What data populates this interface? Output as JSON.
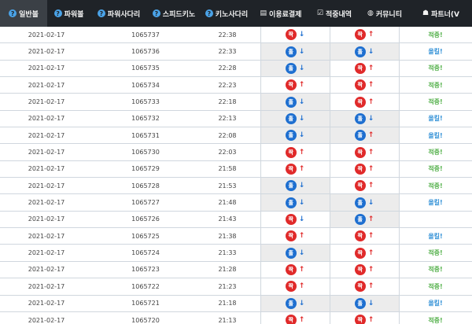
{
  "nav": {
    "items": [
      {
        "label": "일반볼",
        "icon": "question-icon",
        "glyph": "?",
        "active": true
      },
      {
        "label": "파워볼",
        "icon": "question-icon",
        "glyph": "?",
        "active": false
      },
      {
        "label": "파워사다리",
        "icon": "question-icon",
        "glyph": "?",
        "active": false
      },
      {
        "label": "스피드키노",
        "icon": "question-icon",
        "glyph": "?",
        "active": false
      },
      {
        "label": "키노사다리",
        "icon": "question-icon",
        "glyph": "?",
        "active": false
      },
      {
        "label": "이용료결제",
        "icon": "document-icon",
        "glyph": "▤",
        "active": false
      },
      {
        "label": "적중내역",
        "icon": "checkbox-icon",
        "glyph": "☑",
        "active": false
      },
      {
        "label": "커뮤니티",
        "icon": "globe-icon",
        "glyph": "◍",
        "active": false
      },
      {
        "label": "파트너(V",
        "icon": "users-icon",
        "glyph": "☗",
        "active": false
      }
    ]
  },
  "colors": {
    "navbar": "#1f2328",
    "odd_ball": "#e02a2a",
    "even_ball": "#1e6fd0",
    "hit": "#53b04a",
    "miss": "#2f8fd6"
  },
  "rows": [
    {
      "date": "2021-02-17",
      "round": "1065737",
      "time": "22:38",
      "p1": "짝",
      "p1_arrow": "↓",
      "p2": "짝",
      "p2_arrow": "↑",
      "result": "적중!",
      "grey1": false,
      "grey2": false
    },
    {
      "date": "2021-02-17",
      "round": "1065736",
      "time": "22:33",
      "p1": "홀",
      "p1_arrow": "↓",
      "p2": "홀",
      "p2_arrow": "↓",
      "result": "올킬!",
      "grey1": true,
      "grey2": true
    },
    {
      "date": "2021-02-17",
      "round": "1065735",
      "time": "22:28",
      "p1": "홀",
      "p1_arrow": "↓",
      "p2": "짝",
      "p2_arrow": "↑",
      "result": "적중!",
      "grey1": true,
      "grey2": false
    },
    {
      "date": "2021-02-17",
      "round": "1065734",
      "time": "22:23",
      "p1": "짝",
      "p1_arrow": "↑",
      "p2": "짝",
      "p2_arrow": "↑",
      "result": "적중!",
      "grey1": false,
      "grey2": false
    },
    {
      "date": "2021-02-17",
      "round": "1065733",
      "time": "22:18",
      "p1": "홀",
      "p1_arrow": "↓",
      "p2": "짝",
      "p2_arrow": "↑",
      "result": "적중!",
      "grey1": true,
      "grey2": false
    },
    {
      "date": "2021-02-17",
      "round": "1065732",
      "time": "22:13",
      "p1": "홀",
      "p1_arrow": "↓",
      "p2": "홀",
      "p2_arrow": "↓",
      "result": "올킬!",
      "grey1": true,
      "grey2": true
    },
    {
      "date": "2021-02-17",
      "round": "1065731",
      "time": "22:08",
      "p1": "홀",
      "p1_arrow": "↓",
      "p2": "홀",
      "p2_arrow": "↑",
      "result": "올킬!",
      "grey1": true,
      "grey2": true
    },
    {
      "date": "2021-02-17",
      "round": "1065730",
      "time": "22:03",
      "p1": "짝",
      "p1_arrow": "↑",
      "p2": "짝",
      "p2_arrow": "↑",
      "result": "적중!",
      "grey1": false,
      "grey2": false
    },
    {
      "date": "2021-02-17",
      "round": "1065729",
      "time": "21:58",
      "p1": "짝",
      "p1_arrow": "↑",
      "p2": "짝",
      "p2_arrow": "↑",
      "result": "적중!",
      "grey1": false,
      "grey2": false
    },
    {
      "date": "2021-02-17",
      "round": "1065728",
      "time": "21:53",
      "p1": "홀",
      "p1_arrow": "↓",
      "p2": "짝",
      "p2_arrow": "↑",
      "result": "적중!",
      "grey1": true,
      "grey2": false
    },
    {
      "date": "2021-02-17",
      "round": "1065727",
      "time": "21:48",
      "p1": "홀",
      "p1_arrow": "↓",
      "p2": "홀",
      "p2_arrow": "↓",
      "result": "올킬!",
      "grey1": true,
      "grey2": true
    },
    {
      "date": "2021-02-17",
      "round": "1065726",
      "time": "21:43",
      "p1": "짝",
      "p1_arrow": "↓",
      "p2": "홀",
      "p2_arrow": "↑",
      "result": "",
      "grey1": false,
      "grey2": true
    },
    {
      "date": "2021-02-17",
      "round": "1065725",
      "time": "21:38",
      "p1": "짝",
      "p1_arrow": "↑",
      "p2": "짝",
      "p2_arrow": "↑",
      "result": "올킬!",
      "grey1": false,
      "grey2": false
    },
    {
      "date": "2021-02-17",
      "round": "1065724",
      "time": "21:33",
      "p1": "홀",
      "p1_arrow": "↓",
      "p2": "짝",
      "p2_arrow": "↑",
      "result": "적중!",
      "grey1": true,
      "grey2": false
    },
    {
      "date": "2021-02-17",
      "round": "1065723",
      "time": "21:28",
      "p1": "짝",
      "p1_arrow": "↑",
      "p2": "짝",
      "p2_arrow": "↑",
      "result": "적중!",
      "grey1": false,
      "grey2": false
    },
    {
      "date": "2021-02-17",
      "round": "1065722",
      "time": "21:23",
      "p1": "짝",
      "p1_arrow": "↑",
      "p2": "짝",
      "p2_arrow": "↑",
      "result": "적중!",
      "grey1": false,
      "grey2": false
    },
    {
      "date": "2021-02-17",
      "round": "1065721",
      "time": "21:18",
      "p1": "홀",
      "p1_arrow": "↓",
      "p2": "홀",
      "p2_arrow": "↓",
      "result": "올킬!",
      "grey1": true,
      "grey2": true
    },
    {
      "date": "2021-02-17",
      "round": "1065720",
      "time": "21:13",
      "p1": "짝",
      "p1_arrow": "↑",
      "p2": "짝",
      "p2_arrow": "↑",
      "result": "적중!",
      "grey1": false,
      "grey2": false
    }
  ]
}
